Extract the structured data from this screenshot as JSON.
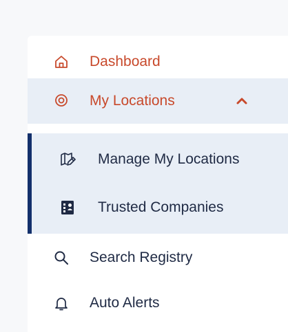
{
  "nav": {
    "dashboard": {
      "label": "Dashboard",
      "icon": "home-icon"
    },
    "my_locations": {
      "label": "My Locations",
      "icon": "location-pin-icon",
      "expanded": true,
      "toggle_icon": "chevron-up-icon"
    },
    "my_locations_children": [
      {
        "label": "Manage My Locations",
        "icon": "edit-map-icon"
      },
      {
        "label": "Trusted Companies",
        "icon": "building-badge-icon"
      }
    ],
    "search_registry": {
      "label": "Search Registry",
      "icon": "search-icon"
    },
    "auto_alerts": {
      "label": "Auto Alerts",
      "icon": "bell-icon"
    }
  },
  "colors": {
    "accent": "#c8492b",
    "text": "#1f2a44",
    "selected_bg": "#e8eef6",
    "active_bar": "#13306b",
    "panel_bg": "#ffffff",
    "page_bg": "#f7f8fa"
  }
}
